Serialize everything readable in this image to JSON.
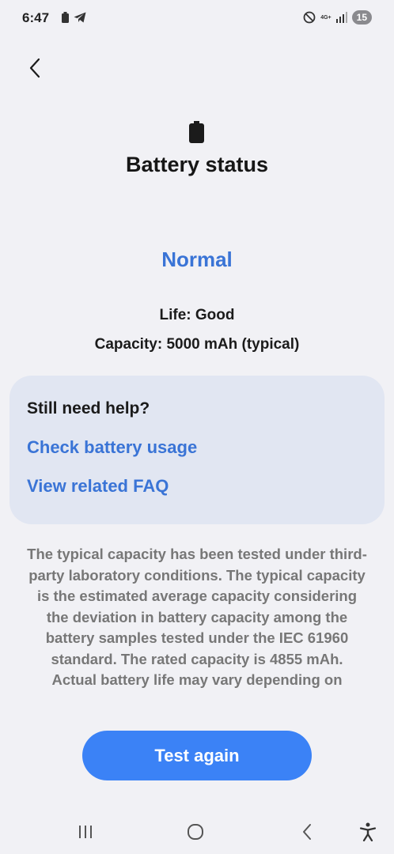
{
  "status_bar": {
    "time": "6:47",
    "network_label": "4G+",
    "notification_count": "15"
  },
  "page": {
    "title": "Battery status",
    "status": "Normal",
    "life": "Life: Good",
    "capacity": "Capacity: 5000 mAh (typical)"
  },
  "help_card": {
    "heading": "Still need help?",
    "links": [
      "Check battery usage",
      "View related FAQ"
    ]
  },
  "disclaimer": "The typical capacity has been tested under third-party laboratory conditions. The typical capacity is the estimated average capacity considering the deviation in battery capacity among the battery samples tested under the IEC 61960 standard. The rated capacity is 4855 mAh. Actual battery life may vary depending on",
  "actions": {
    "test_again": "Test again"
  },
  "icons": {
    "back": "chevron-left-icon",
    "battery": "battery-icon",
    "nav_recents": "recents-icon",
    "nav_home": "home-icon",
    "nav_back": "back-icon",
    "nav_accessibility": "accessibility-icon"
  },
  "colors": {
    "accent": "#3a74d6",
    "button": "#3b82f6",
    "card": "#e1e6f2",
    "background": "#f1f1f5"
  }
}
